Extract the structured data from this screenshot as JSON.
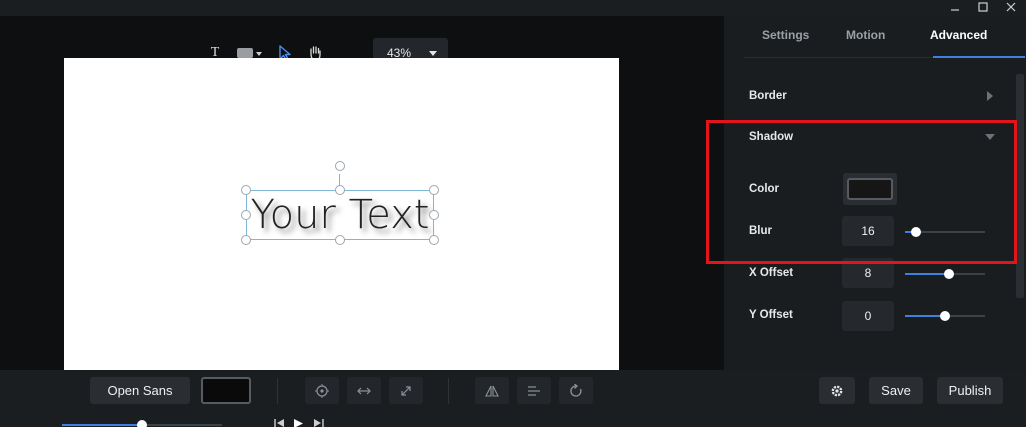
{
  "toolbar": {
    "text_tool_icon": "T",
    "zoom_value": "43%"
  },
  "canvas": {
    "text_content": "Your Text"
  },
  "panel": {
    "tabs": [
      {
        "label": "Settings",
        "active": false
      },
      {
        "label": "Motion",
        "active": false
      },
      {
        "label": "Advanced",
        "active": true
      }
    ],
    "border_label": "Border",
    "shadow_label": "Shadow",
    "color_label": "Color",
    "shadow_color": "#161616",
    "blur": {
      "label": "Blur",
      "value": "16",
      "fraction": 0.14
    },
    "x_offset": {
      "label": "X Offset",
      "value": "8",
      "fraction": 0.55
    },
    "y_offset": {
      "label": "Y Offset",
      "value": "0",
      "fraction": 0.5
    }
  },
  "bottom": {
    "font_name": "Open Sans",
    "text_color": "#0a0a0a",
    "save_label": "Save",
    "publish_label": "Publish",
    "timeline_progress": 0.5
  },
  "colors": {
    "accent": "#3f7fe0",
    "highlight": "#e3151a"
  }
}
